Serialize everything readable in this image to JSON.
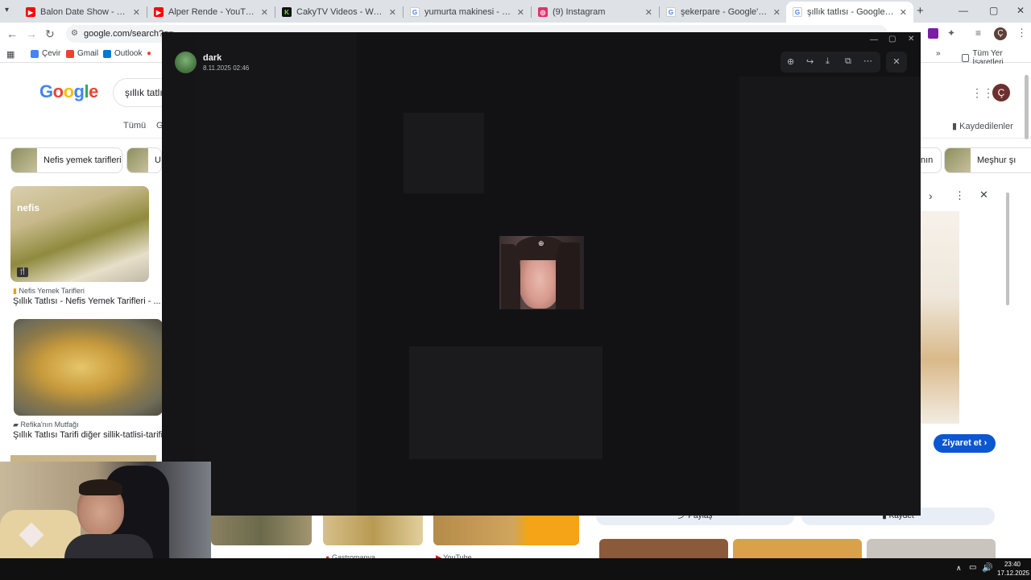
{
  "browser": {
    "tabs": [
      {
        "title": "Balon Date Show - YouTube",
        "icon": "youtube-icon",
        "color": "#ff0000"
      },
      {
        "title": "Alper Rende - YouTube",
        "icon": "youtube-icon",
        "color": "#ff0000"
      },
      {
        "title": "CakyTV Videos - Watch On-De",
        "icon": "kick-icon",
        "color": "#53fc18"
      },
      {
        "title": "yumurta makinesi - Google'da",
        "icon": "google-icon",
        "color": "#4285f4"
      },
      {
        "title": "(9) Instagram",
        "icon": "instagram-icon",
        "color": "#e1306c"
      },
      {
        "title": "şekerpare - Google'da Ara",
        "icon": "google-icon",
        "color": "#4285f4"
      },
      {
        "title": "şıllık tatlısı - Google'da Ara",
        "icon": "google-icon",
        "color": "#4285f4",
        "active": true
      }
    ],
    "new_tab": "+",
    "url": "google.com/search?q=",
    "bookmarks": [
      "Çevir",
      "Gmail",
      "Outlook"
    ],
    "all_bookmarks": "Tüm Yer İşaretleri",
    "profile_initial": "Ç"
  },
  "google": {
    "logo": "Google",
    "query": "şıllık tatlı",
    "tabs": [
      "Tümü",
      "G"
    ],
    "saved": "Kaydedilenler",
    "chips": [
      "Nefis yemek tarifleri",
      "U",
      "nın",
      "Meşhur şı"
    ],
    "results": [
      {
        "source": "Nefis Yemek Tarifleri",
        "title": "Şıllık Tatlısı - Nefis Yemek Tarifleri - ..."
      },
      {
        "source": "Refika'nın Mutfağı",
        "title": "Şıllık Tatlısı Tarifi diğer sillik-tatlisi-tarifi"
      }
    ],
    "bottom_sources": [
      "Gastromanya",
      "YouTube"
    ],
    "visit_button": "Ziyaret et",
    "share_button": "Paylaş",
    "save_button": "Kaydet"
  },
  "viewer": {
    "sender": "dark",
    "timestamp": "8.11.2025 02:46",
    "tools": [
      "zoom-in-icon",
      "forward-icon",
      "download-icon",
      "open-external-icon",
      "more-icon"
    ],
    "close": "✕"
  },
  "taskbar": {
    "time": "23:40",
    "date": "17.12.2025"
  }
}
